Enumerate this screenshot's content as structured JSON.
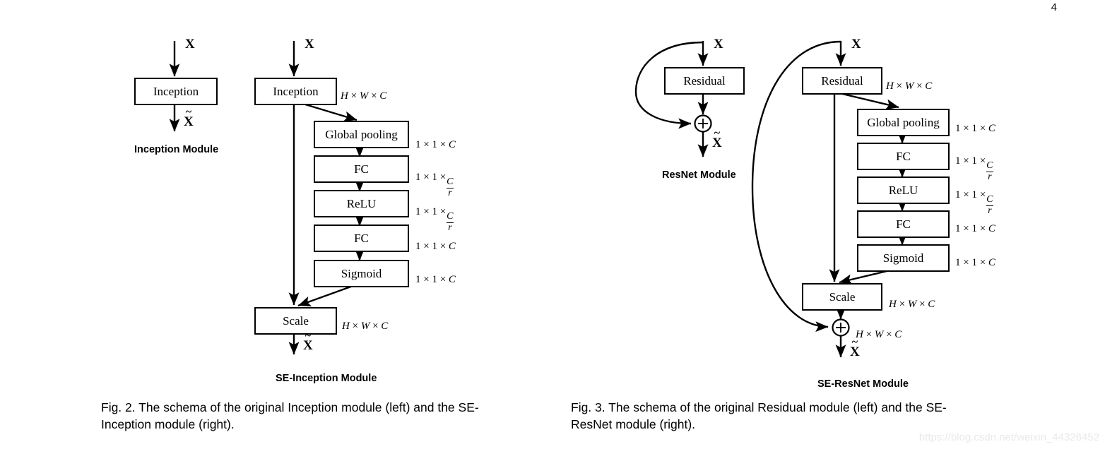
{
  "page": {
    "number": "4",
    "watermark": "https://blog.csdn.net/weixin_44326452"
  },
  "figure2": {
    "caption_line1": "Fig. 2. The schema of the original Inception module (left) and the SE-",
    "caption_line2": "Inception module (right).",
    "inception_module": {
      "title": "Inception Module",
      "input_label": "X",
      "output_label": "X",
      "block": "Inception"
    },
    "se_inception_module": {
      "title": "SE-Inception Module",
      "input_label": "X",
      "output_label": "X",
      "blocks": [
        {
          "name": "Inception",
          "dim": "H x W x C"
        },
        {
          "name": "Global pooling",
          "dim": "1 x 1 x C"
        },
        {
          "name": "FC",
          "dim": "1 x 1 x C/r"
        },
        {
          "name": "ReLU",
          "dim": "1 x 1 x C/r"
        },
        {
          "name": "FC",
          "dim": "1 x 1 x C"
        },
        {
          "name": "Sigmoid",
          "dim": "1 x 1 x C"
        },
        {
          "name": "Scale",
          "dim": "H x W x C"
        }
      ]
    }
  },
  "figure3": {
    "caption_line1": "Fig. 3. The schema of the original Residual module (left) and the SE-",
    "caption_line2": "ResNet module (right).",
    "resnet_module": {
      "title": "ResNet Module",
      "input_label": "X",
      "output_label": "X",
      "block": "Residual",
      "sum_symbol": "+"
    },
    "se_resnet_module": {
      "title": "SE-ResNet Module",
      "input_label": "X",
      "output_label": "X",
      "sum_symbol": "+",
      "sum_dim": "H x W x C",
      "blocks": [
        {
          "name": "Residual",
          "dim": "H x W x C"
        },
        {
          "name": "Global pooling",
          "dim": "1 x 1 x C"
        },
        {
          "name": "FC",
          "dim": "1 x 1 x C/r"
        },
        {
          "name": "ReLU",
          "dim": "1 x 1 x C/r"
        },
        {
          "name": "FC",
          "dim": "1 x 1 x C"
        },
        {
          "name": "Sigmoid",
          "dim": "1 x 1 x C"
        },
        {
          "name": "Scale",
          "dim": "H x W x C"
        }
      ]
    }
  }
}
